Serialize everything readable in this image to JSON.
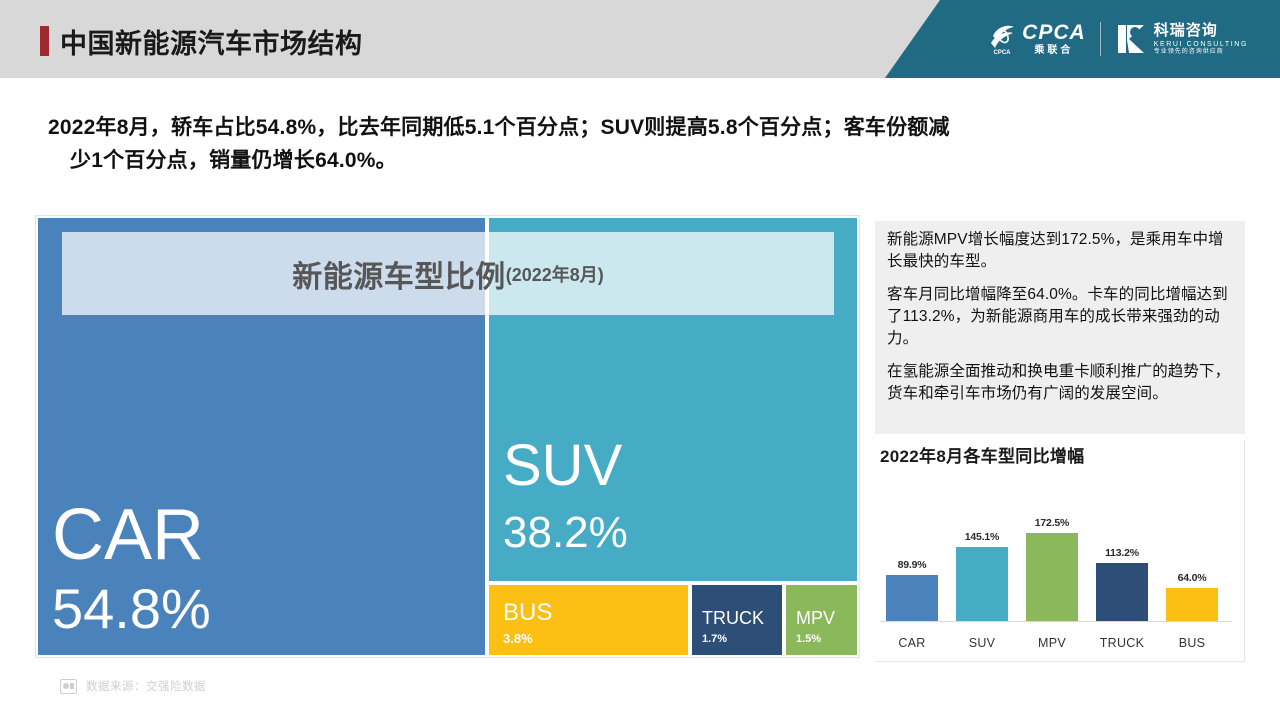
{
  "header": {
    "title": "中国新能源汽车市场结构",
    "logo_cpca_name": "CPCA",
    "logo_cpca_sub": "乘联合",
    "logo_cpca_mark": "CPCA",
    "logo_kerui_cn": "科瑞咨询",
    "logo_kerui_en": "KERUI CONSULTING",
    "logo_kerui_tag": "专业领先的咨询供应商",
    "accent_color": "#9e2a2f",
    "banner_color": "#216a84"
  },
  "subtitle": {
    "line1": "2022年8月，轿车占比54.8%，比去年同期低5.1个百分点；SUV则提高5.8个百分点；客车份额减",
    "line2": "少1个百分点，销量仍增长64.0%。"
  },
  "treemap": {
    "title_main": "新能源车型比例",
    "title_sub": "(2022年8月)",
    "blocks": [
      {
        "name": "CAR",
        "value": "54.8%",
        "color": "#4a82bc"
      },
      {
        "name": "SUV",
        "value": "38.2%",
        "color": "#46abc4"
      },
      {
        "name": "BUS",
        "value": "3.8%",
        "color": "#fcbf13"
      },
      {
        "name": "TRUCK",
        "value": "1.7%",
        "color": "#2d4f77"
      },
      {
        "name": "MPV",
        "value": "1.5%",
        "color": "#8cb85c"
      }
    ]
  },
  "notes": {
    "p1": "新能源MPV增长幅度达到172.5%，是乘用车中增长最快的车型。",
    "p2": "客车月同比增幅降至64.0%。卡车的同比增幅达到了113.2%，为新能源商用车的成长带来强劲的动力。",
    "p3": "在氢能源全面推动和换电重卡顺利推广的趋势下，货车和牵引车市场仍有广阔的发展空间。"
  },
  "chart_data": {
    "type": "bar",
    "title": "2022年8月各车型同比增幅",
    "xlabel": "",
    "ylabel": "",
    "ylim": [
      0,
      200
    ],
    "grid": false,
    "legend": "none",
    "categories": [
      "CAR",
      "SUV",
      "MPV",
      "TRUCK",
      "BUS"
    ],
    "values": [
      89.9,
      145.1,
      172.5,
      113.2,
      64.0
    ],
    "data_labels": [
      "89.9%",
      "145.1%",
      "172.5%",
      "113.2%",
      "64.0%"
    ],
    "colors": [
      "#4a82bc",
      "#46abc4",
      "#8cb85c",
      "#2d4f77",
      "#fcbf13"
    ]
  },
  "footer": {
    "source_text": "数据来源：交强险数据",
    "source_icon": "chart-icon"
  }
}
